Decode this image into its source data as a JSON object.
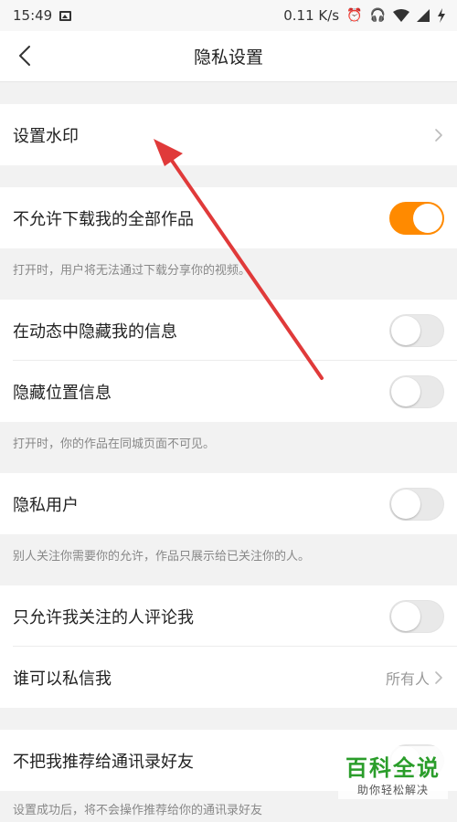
{
  "status_bar": {
    "time": "15:49",
    "speed": "0.11 K/s"
  },
  "nav": {
    "title": "隐私设置"
  },
  "rows": {
    "watermark": "设置水印",
    "no_download": "不允许下载我的全部作品",
    "no_download_hint": "打开时，用户将无法通过下载分享你的视频。",
    "hide_in_feed": "在动态中隐藏我的信息",
    "hide_location": "隐藏位置信息",
    "hide_location_hint": "打开时，你的作品在同城页面不可见。",
    "private_user": "隐私用户",
    "private_user_hint": "别人关注你需要你的允许，作品只展示给已关注你的人。",
    "comment_only_following": "只允许我关注的人评论我",
    "who_can_message": "谁可以私信我",
    "who_can_message_value": "所有人",
    "no_recommend_contacts": "不把我推荐给通讯录好友",
    "no_recommend_contacts_hint": "设置成功后，将不会操作推荐给你的通讯录好友"
  },
  "toggles": {
    "no_download": true,
    "hide_in_feed": false,
    "hide_location": false,
    "private_user": false,
    "comment_only_following": false,
    "no_recommend_contacts": false
  },
  "watermark_logo": {
    "main": "百科全说",
    "sub": "助你轻松解决"
  },
  "colors": {
    "accent": "#ff8a00",
    "annotation_arrow": "#e03a3a",
    "logo_green": "#2a9d2a"
  }
}
